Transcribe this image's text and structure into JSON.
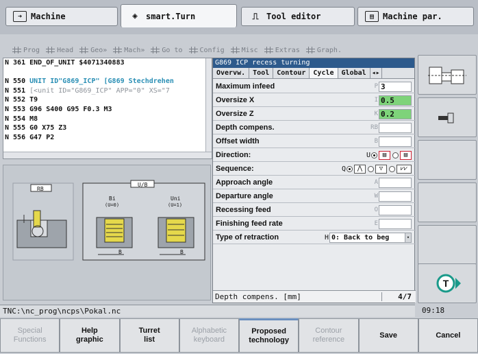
{
  "mode_tabs": [
    {
      "label": "Machine",
      "icon": "arrow-right-icon"
    },
    {
      "label": "smart.Turn",
      "icon": "diamond-arrow-icon"
    },
    {
      "label": "Tool editor",
      "icon": "tool-icon"
    },
    {
      "label": "Machine par.",
      "icon": "machine-param-icon"
    }
  ],
  "menu": [
    "Prog",
    "Head",
    "Geo»",
    "Mach»",
    "Go to",
    "Config",
    "Misc",
    "Extras",
    "Graph."
  ],
  "program_lines": [
    {
      "n": "N 361",
      "text": "END_OF_UNIT $4071340883",
      "style": "plain"
    },
    {
      "n": "",
      "text": "",
      "style": "blank"
    },
    {
      "n": "N 550",
      "text": "UNIT ID\"G869_ICP\" [G869 Stechdrehen",
      "style": "unit"
    },
    {
      "n": "N 551",
      "text": "  [<unit ID=\"G869_ICP\" APP=\"0\" XS=\"7",
      "style": "grey"
    },
    {
      "n": "N 552",
      "text": "  T9",
      "style": "plain"
    },
    {
      "n": "N 553",
      "text": "  G96 S400 G95 F0.3 M3",
      "style": "plain"
    },
    {
      "n": "N 554",
      "text": "  M8",
      "style": "plain"
    },
    {
      "n": "N 555",
      "text": "  G0 X75 Z3",
      "style": "plain"
    },
    {
      "n": "N 556",
      "text": "  G47 P2",
      "style": "plain"
    }
  ],
  "help_graphic": {
    "rb_label": "RB",
    "ub_label": "U/B",
    "bi_label": "Bi",
    "bi_sub": "(U=0)",
    "uni_label": "Uni",
    "uni_sub": "(U=1)",
    "b_label": "B"
  },
  "dialog": {
    "title": "G869 ICP recess turning",
    "tabs": [
      "Overvw.",
      "Tool",
      "Contour",
      "Cycle",
      "Global"
    ],
    "active_tab": "Cycle",
    "fields": [
      {
        "label": "Maximum infeed",
        "addr": "P",
        "value": "3",
        "highlight": false
      },
      {
        "label": "Oversize X",
        "addr": "I",
        "value": "0.5",
        "highlight": true
      },
      {
        "label": "Oversize Z",
        "addr": "K",
        "value": "0.2",
        "highlight": true
      },
      {
        "label": "Depth compens.",
        "addr": "RB",
        "value": "",
        "highlight": false
      },
      {
        "label": "Offset width",
        "addr": "B",
        "value": "",
        "highlight": false
      }
    ],
    "direction_label": "Direction:",
    "direction_addr": "U",
    "sequence_label": "Sequence:",
    "sequence_addr": "Q",
    "fields2": [
      {
        "label": "Approach angle",
        "addr": "A",
        "value": ""
      },
      {
        "label": "Departure angle",
        "addr": "W",
        "value": ""
      },
      {
        "label": "Recessing feed",
        "addr": "O",
        "value": ""
      },
      {
        "label": "Finishing feed rate",
        "addr": "E",
        "value": ""
      }
    ],
    "retraction_label": "Type of retraction",
    "retraction_addr": "H",
    "retraction_value": "0: Back to beg",
    "status_hint": "Depth compens. [mm]",
    "page": "4/7"
  },
  "path": "TNC:\\nc_prog\\ncps\\Pokal.nc",
  "clock": "09:18",
  "softkeys": [
    {
      "label": "Special\nFunctions",
      "enabled": false
    },
    {
      "label": "Help\ngraphic",
      "enabled": true
    },
    {
      "label": "Turret\nlist",
      "enabled": true
    },
    {
      "label": "Alphabetic\nkeyboard",
      "enabled": false
    },
    {
      "label": "Proposed\ntechnology",
      "enabled": true
    },
    {
      "label": "Contour\nreference",
      "enabled": false
    },
    {
      "label": "Save",
      "enabled": true
    },
    {
      "label": "Cancel",
      "enabled": true
    }
  ]
}
